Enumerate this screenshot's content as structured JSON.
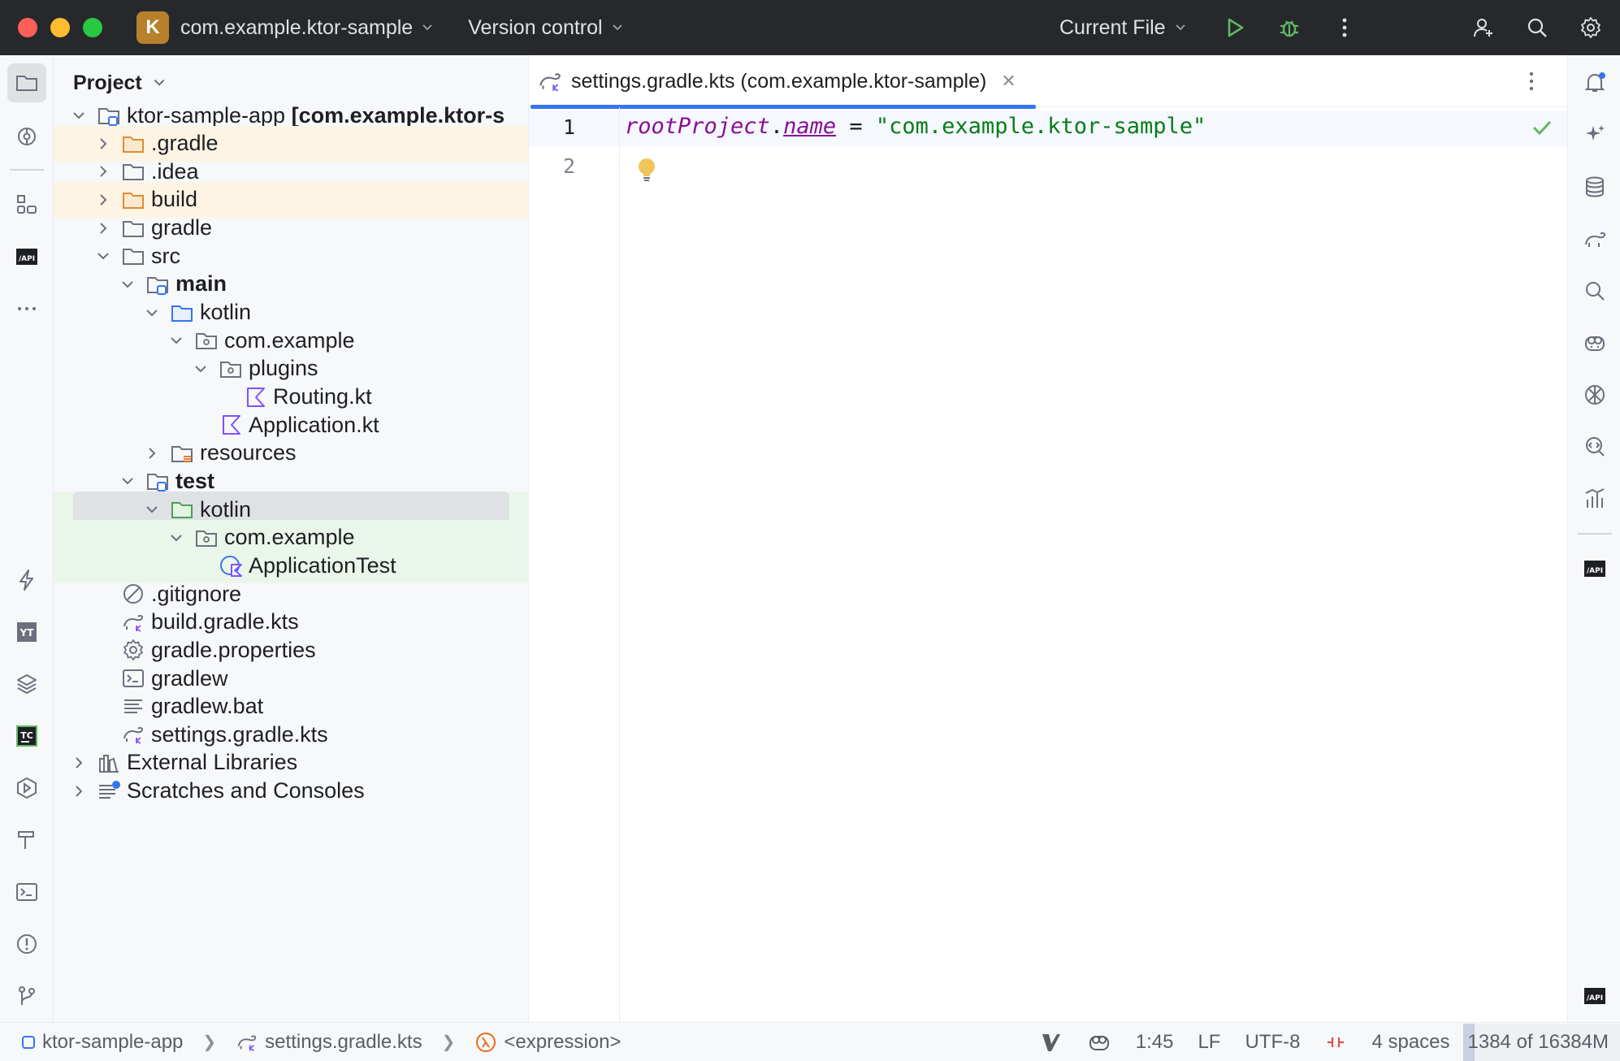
{
  "titlebar": {
    "project_badge": "K",
    "project_name": "com.example.ktor-sample",
    "vcs_label": "Version control",
    "run_config": "Current File"
  },
  "project_panel": {
    "title": "Project",
    "tree": [
      {
        "label": "ktor-sample-app [com.example.ktor-sample]",
        "bold_part": "[com.example.ktor-s",
        "icon": "module-folder-icon",
        "depth": 0,
        "chevron": "down",
        "style": ""
      },
      {
        "label": ".gradle",
        "icon": "folder-excluded-icon",
        "depth": 1,
        "chevron": "right",
        "style": "excl"
      },
      {
        "label": ".idea",
        "icon": "folder-icon",
        "depth": 1,
        "chevron": "right",
        "style": ""
      },
      {
        "label": "build",
        "icon": "folder-excluded-icon",
        "depth": 1,
        "chevron": "right",
        "style": "excl"
      },
      {
        "label": "gradle",
        "icon": "folder-icon",
        "depth": 1,
        "chevron": "right",
        "style": ""
      },
      {
        "label": "src",
        "icon": "folder-icon",
        "depth": 1,
        "chevron": "down",
        "style": ""
      },
      {
        "label": "main",
        "icon": "module-folder-icon",
        "depth": 2,
        "chevron": "down",
        "style": "",
        "bold": true
      },
      {
        "label": "kotlin",
        "icon": "source-folder-icon",
        "depth": 3,
        "chevron": "down",
        "style": ""
      },
      {
        "label": "com.example",
        "icon": "package-icon",
        "depth": 4,
        "chevron": "down",
        "style": ""
      },
      {
        "label": "plugins",
        "icon": "package-icon",
        "depth": 5,
        "chevron": "down",
        "style": ""
      },
      {
        "label": "Routing.kt",
        "icon": "kotlin-file-icon",
        "depth": 6,
        "chevron": "none",
        "style": ""
      },
      {
        "label": "Application.kt",
        "icon": "kotlin-file-icon",
        "depth": 5,
        "chevron": "none",
        "style": ""
      },
      {
        "label": "resources",
        "icon": "resources-folder-icon",
        "depth": 3,
        "chevron": "right",
        "style": ""
      },
      {
        "label": "test",
        "icon": "module-folder-icon",
        "depth": 2,
        "chevron": "down",
        "style": "",
        "bold": true
      },
      {
        "label": "kotlin",
        "icon": "test-folder-icon",
        "depth": 3,
        "chevron": "down",
        "style": "test",
        "selected": true
      },
      {
        "label": "com.example",
        "icon": "package-icon",
        "depth": 4,
        "chevron": "down",
        "style": "test"
      },
      {
        "label": "ApplicationTest",
        "icon": "kotlin-test-class-icon",
        "depth": 5,
        "chevron": "none",
        "style": "test"
      },
      {
        "label": ".gitignore",
        "icon": "ignore-file-icon",
        "depth": 1,
        "chevron": "none",
        "style": ""
      },
      {
        "label": "build.gradle.kts",
        "icon": "gradle-kts-icon",
        "depth": 1,
        "chevron": "none",
        "style": ""
      },
      {
        "label": "gradle.properties",
        "icon": "settings-file-icon",
        "depth": 1,
        "chevron": "none",
        "style": ""
      },
      {
        "label": "gradlew",
        "icon": "shell-script-icon",
        "depth": 1,
        "chevron": "none",
        "style": ""
      },
      {
        "label": "gradlew.bat",
        "icon": "text-file-icon",
        "depth": 1,
        "chevron": "none",
        "style": ""
      },
      {
        "label": "settings.gradle.kts",
        "icon": "gradle-kts-icon",
        "depth": 1,
        "chevron": "none",
        "style": ""
      },
      {
        "label": "External Libraries",
        "icon": "libraries-icon",
        "depth": 0,
        "chevron": "right",
        "style": ""
      },
      {
        "label": "Scratches and Consoles",
        "icon": "scratches-icon",
        "depth": 0,
        "chevron": "right",
        "style": ""
      }
    ]
  },
  "editor": {
    "tab_title": "settings.gradle.kts (com.example.ktor-sample)",
    "line_numbers": [
      "1",
      "2"
    ],
    "code": {
      "fn": "rootProject",
      "dot": ".",
      "prop": "name",
      "op": " = ",
      "str": "\"com.example.ktor-sample\""
    }
  },
  "statusbar": {
    "crumb_module": "ktor-sample-app",
    "crumb_file": "settings.gradle.kts",
    "crumb_expr": "<expression>",
    "position": "1:45",
    "line_sep": "LF",
    "encoding": "UTF-8",
    "indent": "4 spaces",
    "memory": "1384 of 16384M"
  },
  "colors": {
    "accent": "#3574f0",
    "string": "#067d17",
    "keyword_italic": "#871094",
    "excluded_bg": "#fdf4e3",
    "test_bg": "#eaf6ea"
  }
}
